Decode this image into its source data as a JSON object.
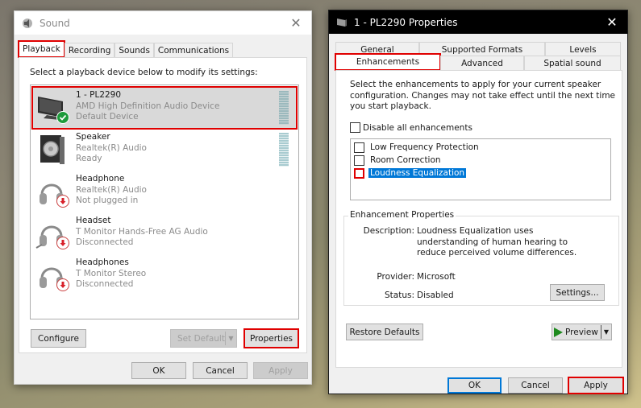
{
  "sound_window": {
    "title": "Sound",
    "close_glyph": "✕",
    "tabs": [
      {
        "label": "Playback",
        "active": true,
        "highlighted": true
      },
      {
        "label": "Recording",
        "active": false
      },
      {
        "label": "Sounds",
        "active": false
      },
      {
        "label": "Communications",
        "active": false
      }
    ],
    "instruction": "Select a playback device below to modify its settings:",
    "devices": [
      {
        "name": "1 - PL2290",
        "driver": "AMD High Definition Audio Device",
        "status": "Default Device",
        "icon": "monitor-icon",
        "badge": "default-check-icon",
        "selected": true,
        "meter": true
      },
      {
        "name": "Speaker",
        "driver": "Realtek(R) Audio",
        "status": "Ready",
        "icon": "speaker-icon",
        "meter": true
      },
      {
        "name": "Headphone",
        "driver": "Realtek(R) Audio",
        "status": "Not plugged in",
        "icon": "headphone-icon",
        "badge": "unplugged-arrow-icon"
      },
      {
        "name": "Headset",
        "driver": "T Monitor Hands-Free AG Audio",
        "status": "Disconnected",
        "icon": "headset-icon",
        "badge": "unplugged-arrow-icon"
      },
      {
        "name": "Headphones",
        "driver": "T Monitor Stereo",
        "status": "Disconnected",
        "icon": "headphone-icon",
        "badge": "unplugged-arrow-icon"
      }
    ],
    "buttons": {
      "configure": "Configure",
      "set_default": "Set Default",
      "properties": "Properties",
      "ok": "OK",
      "cancel": "Cancel",
      "apply": "Apply"
    }
  },
  "properties_window": {
    "title": "1 - PL2290 Properties",
    "close_glyph": "✕",
    "tabs_row1": [
      {
        "label": "General"
      },
      {
        "label": "Supported Formats"
      },
      {
        "label": "Levels"
      }
    ],
    "tabs_row2": [
      {
        "label": "Enhancements",
        "active": true,
        "highlighted": true
      },
      {
        "label": "Advanced"
      },
      {
        "label": "Spatial sound"
      }
    ],
    "instruction": "Select the enhancements to apply for your current speaker configuration. Changes may not take effect until the next time you start playback.",
    "disable_all_label": "Disable all enhancements",
    "disable_all_checked": false,
    "enhancements": [
      {
        "label": "Low Frequency Protection",
        "checked": false,
        "selected": false
      },
      {
        "label": "Room Correction",
        "checked": false,
        "selected": false
      },
      {
        "label": "Loudness Equalization",
        "checked": false,
        "selected": true
      }
    ],
    "group_title": "Enhancement Properties",
    "description_key": "Description:",
    "description_value": "Loudness Equalization uses understanding of human hearing to reduce perceived volume differences.",
    "provider_key": "Provider:",
    "provider_value": "Microsoft",
    "status_key": "Status:",
    "status_value": "Disabled",
    "buttons": {
      "settings": "Settings...",
      "restore_defaults": "Restore Defaults",
      "preview": "Preview",
      "ok": "OK",
      "cancel": "Cancel",
      "apply": "Apply"
    }
  },
  "colors": {
    "highlight_red": "#e00000",
    "selection_blue": "#0078d7",
    "check_green": "#1e9b3c"
  }
}
